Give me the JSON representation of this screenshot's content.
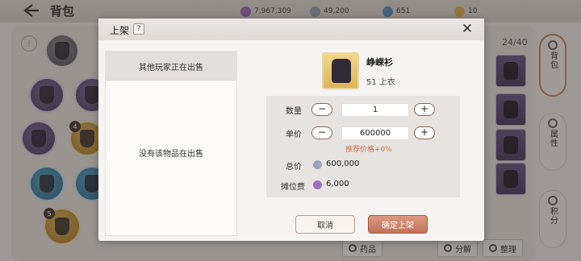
{
  "header": {
    "title": "背包"
  },
  "currencies": [
    {
      "icon": "purple-gem-icon",
      "value": "7,967,309",
      "color": "#9b6fc4"
    },
    {
      "icon": "silver-coin-icon",
      "value": "49,200",
      "color": "#9aa3b8"
    },
    {
      "icon": "blue-gem-icon",
      "value": "651",
      "color": "#5f8fc4"
    },
    {
      "icon": "gold-coin-icon",
      "value": "10",
      "color": "#e0b44c"
    }
  ],
  "inventory": {
    "count": "24/40",
    "badges": [
      "4",
      "5"
    ],
    "slot_icons": [
      "helmet-icon",
      "armor-icon",
      "amulet-icon",
      "pants-icon",
      "gourd-icon",
      "gem-icon",
      "boots-icon",
      "boots-icon",
      "gourd-icon",
      "helmet-icon",
      "staff-icon",
      "sword-icon"
    ]
  },
  "side_tabs": [
    {
      "label": "背包",
      "icon": "bag-icon"
    },
    {
      "label": "属性",
      "icon": "attribute-icon"
    },
    {
      "label": "积分",
      "icon": "points-icon"
    }
  ],
  "bottom_buttons": [
    {
      "label": "药品",
      "icon": "potion-icon"
    },
    {
      "label": "分解",
      "icon": "decompose-icon"
    },
    {
      "label": "整理",
      "icon": "sort-icon"
    }
  ],
  "modal": {
    "title": "上架",
    "help": "?",
    "close": "✕",
    "left_pane": {
      "header": "其他玩家正在出售",
      "empty_text": "没有该物品在出售"
    },
    "item": {
      "name": "峥嵘衫",
      "level_type": "51 上衣",
      "icon": "vest-armor-icon"
    },
    "form": {
      "quantity_label": "数量",
      "quantity_value": "1",
      "price_label": "单价",
      "price_value": "600000",
      "minus": "−",
      "plus": "+",
      "suggested": "推荐价格+0%",
      "total_label": "总价",
      "total_value": "600,000",
      "total_icon": "silver-coin-icon",
      "fee_label": "摊位费",
      "fee_value": "6,000",
      "fee_icon": "purple-gem-icon"
    },
    "cancel": "取消",
    "confirm": "确定上架"
  }
}
